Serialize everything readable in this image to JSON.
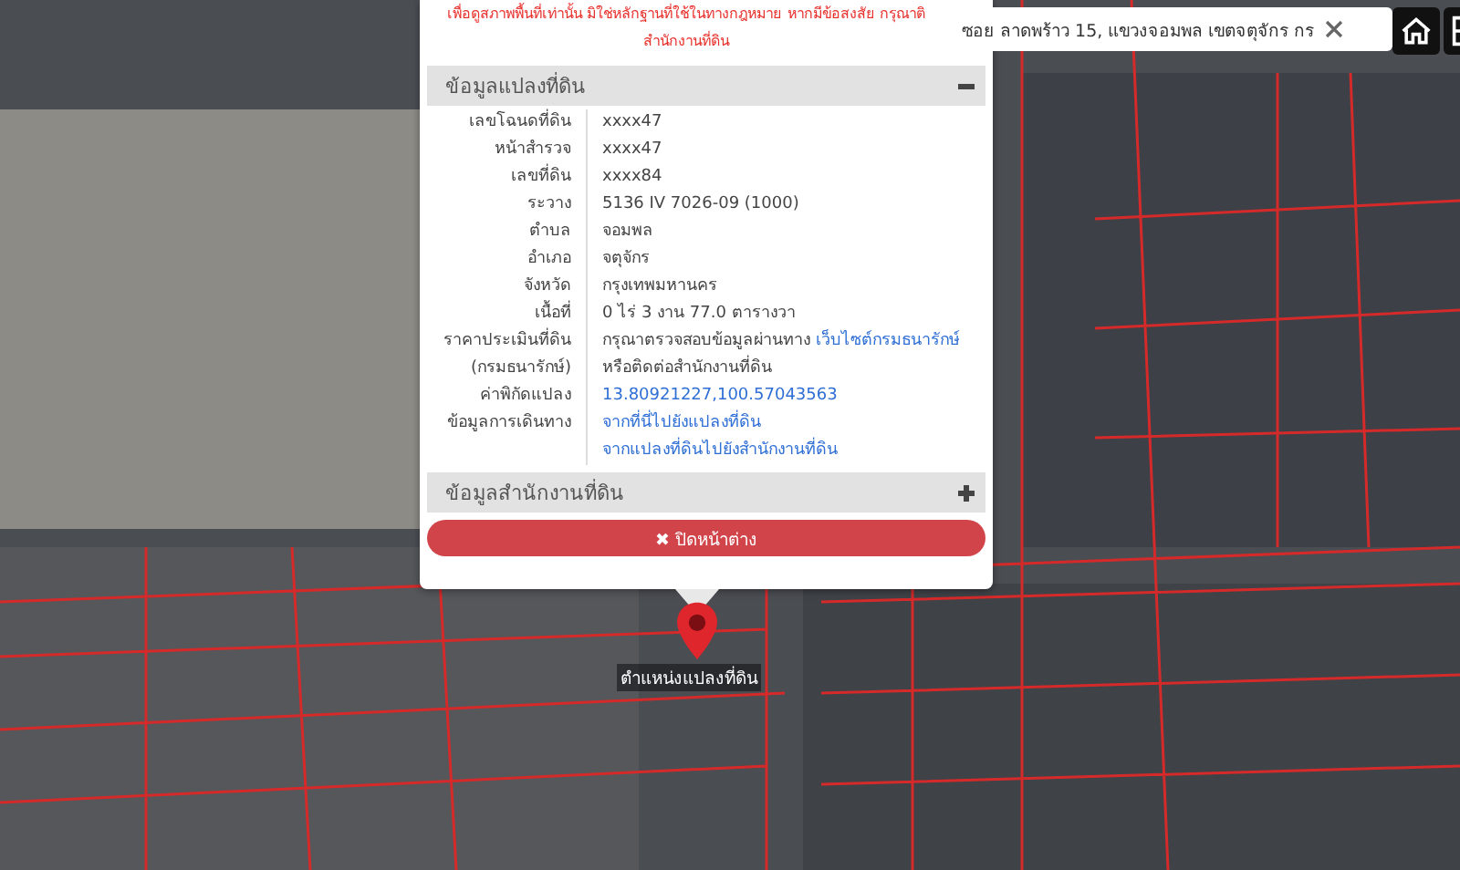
{
  "notice": {
    "lines": [
      "เพื่อดูสภาพพื้นที่เท่านั้น มิใช่หลักฐานที่ใช้ในทางกฎหมาย หากมีข้อสงสัย กรุณาติ",
      "สำนักงานที่ดิน"
    ]
  },
  "sections": [
    {
      "title": "ข้อมูลแปลงที่ดิน",
      "expanded": true,
      "rows": [
        {
          "label_lines": [
            "เลขโฉนดที่ดิน"
          ],
          "lines": [
            [
              {
                "kind": "text",
                "text": "xxxx47"
              }
            ]
          ]
        },
        {
          "label_lines": [
            "หน้าสำรวจ"
          ],
          "lines": [
            [
              {
                "kind": "text",
                "text": "xxxx47"
              }
            ]
          ]
        },
        {
          "label_lines": [
            "เลขที่ดิน"
          ],
          "lines": [
            [
              {
                "kind": "text",
                "text": "xxxx84"
              }
            ]
          ]
        },
        {
          "label_lines": [
            "ระวาง"
          ],
          "lines": [
            [
              {
                "kind": "text",
                "text": "5136 IV 7026-09 (1000)"
              }
            ]
          ]
        },
        {
          "label_lines": [
            "ตำบล"
          ],
          "lines": [
            [
              {
                "kind": "text",
                "text": "จอมพล"
              }
            ]
          ]
        },
        {
          "label_lines": [
            "อำเภอ"
          ],
          "lines": [
            [
              {
                "kind": "text",
                "text": "จตุจักร"
              }
            ]
          ]
        },
        {
          "label_lines": [
            "จังหวัด"
          ],
          "lines": [
            [
              {
                "kind": "text",
                "text": "กรุงเทพมหานคร"
              }
            ]
          ]
        },
        {
          "label_lines": [
            "เนื้อที่"
          ],
          "lines": [
            [
              {
                "kind": "text",
                "text": "0 ไร่ 3 งาน 77.0 ตารางวา"
              }
            ]
          ]
        },
        {
          "label_lines": [
            "ราคาประเมินที่ดิน",
            "(กรมธนารักษ์)"
          ],
          "lines": [
            [
              {
                "kind": "text",
                "text": "กรุณาตรวจสอบข้อมูลผ่านทาง "
              },
              {
                "kind": "link",
                "text": "เว็บไซต์กรมธนารักษ์"
              }
            ],
            [
              {
                "kind": "text",
                "text": "หรือติดต่อสำนักงานที่ดิน"
              }
            ]
          ]
        },
        {
          "label_lines": [
            "ค่าพิกัดแปลง"
          ],
          "lines": [
            [
              {
                "kind": "link",
                "text": "13.80921227,100.57043563"
              }
            ]
          ]
        },
        {
          "label_lines": [
            "ข้อมูลการเดินทาง"
          ],
          "lines": [
            [
              {
                "kind": "link",
                "text": "จากที่นี่ไปยังแปลงที่ดิน"
              }
            ],
            [
              {
                "kind": "link",
                "text": "จากแปลงที่ดินไปยังสำนักงานที่ดิน"
              }
            ]
          ]
        }
      ]
    },
    {
      "title": "ข้อมูลสำนักงานที่ดิน",
      "expanded": false
    }
  ],
  "close_button": {
    "label": "✖ ปิดหน้าต่าง"
  },
  "search": {
    "value": "ซอย ลาดพร้าว 15, แขวงจอมพล เขตจตุจักร กร"
  },
  "map": {
    "pin_label": "ตำแหน่งแปลงที่ดิน"
  }
}
